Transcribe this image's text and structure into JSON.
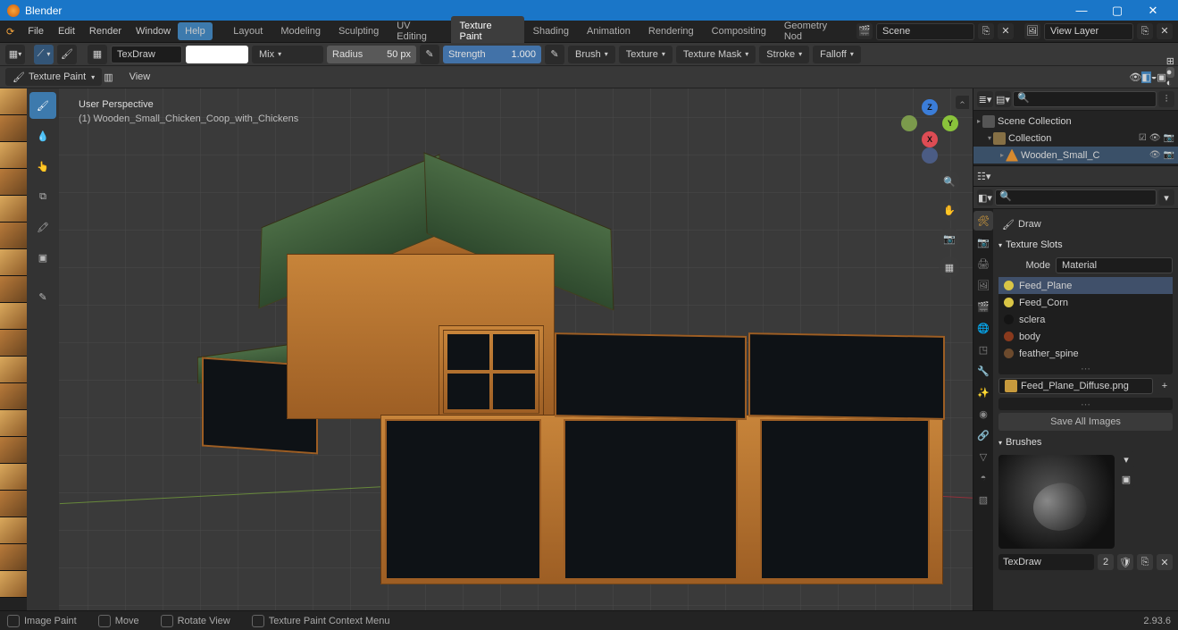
{
  "app": {
    "title": "Blender"
  },
  "menu": {
    "file": "File",
    "edit": "Edit",
    "render": "Render",
    "window": "Window",
    "help": "Help"
  },
  "workspaces": [
    "Layout",
    "Modeling",
    "Sculpting",
    "UV Editing",
    "Texture Paint",
    "Shading",
    "Animation",
    "Rendering",
    "Compositing",
    "Geometry Nod"
  ],
  "workspace_active": "Texture Paint",
  "scene": {
    "label": "Scene",
    "layer": "View Layer"
  },
  "toolhdr": {
    "brush_name": "TexDraw",
    "blend": "Mix",
    "radius_label": "Radius",
    "radius_value": "50 px",
    "strength_label": "Strength",
    "strength_value": "1.000",
    "brush": "Brush",
    "texture": "Texture",
    "texmask": "Texture Mask",
    "stroke": "Stroke",
    "falloff": "Falloff"
  },
  "toolhdr2": {
    "mode": "Texture Paint",
    "view": "View"
  },
  "overlay": {
    "persp": "User Perspective",
    "obj": "(1) Wooden_Small_Chicken_Coop_with_Chickens"
  },
  "gizmo": {
    "x": "X",
    "y": "Y",
    "z": "Z"
  },
  "outliner": {
    "root": "Scene Collection",
    "coll": "Collection",
    "obj": "Wooden_Small_C"
  },
  "props": {
    "draw": "Draw",
    "texslots": "Texture Slots",
    "mode_label": "Mode",
    "mode_value": "Material",
    "slots": [
      {
        "name": "Feed_Plane",
        "color": "#d9c546",
        "sel": true
      },
      {
        "name": "Feed_Corn",
        "color": "#d9c546"
      },
      {
        "name": "sclera",
        "color": "#141414"
      },
      {
        "name": "body",
        "color": "#8a3a1d"
      },
      {
        "name": "feather_spine",
        "color": "#6c4a2d"
      }
    ],
    "image": "Feed_Plane_Diffuse.png",
    "save_all": "Save All Images",
    "brushes": "Brushes",
    "brush_name": "TexDraw",
    "brush_users": "2"
  },
  "status": {
    "paint": "Image Paint",
    "move": "Move",
    "rotate": "Rotate View",
    "ctx": "Texture Paint Context Menu",
    "version": "2.93.6"
  }
}
